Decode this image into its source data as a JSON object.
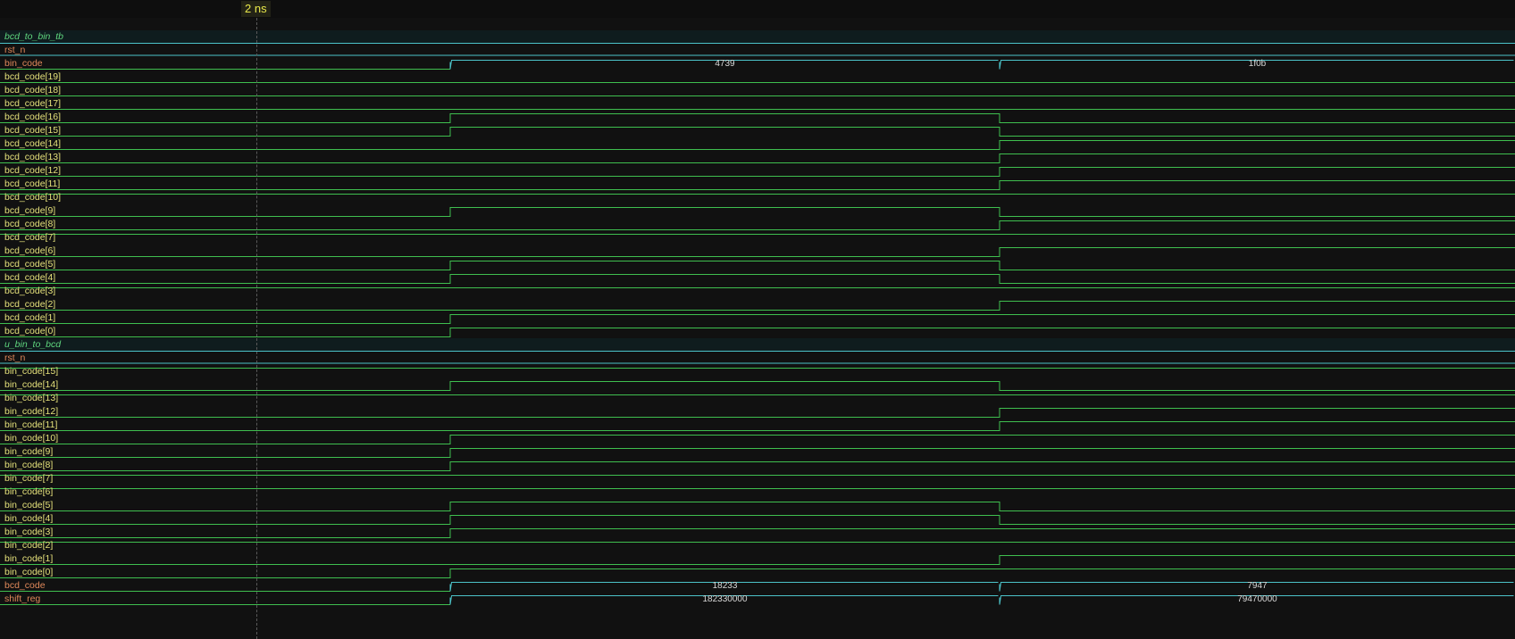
{
  "cursor": {
    "label": "2 ns"
  },
  "colors": {
    "background": "#111111",
    "group_label": "#5fd67e",
    "bit_label": "#e4e07a",
    "bus_label": "#e0885a",
    "wire": "#3fbf4f",
    "bus": "#4cc3c9",
    "cursor_bg": "#232316",
    "cursor_text": "#e8e84a"
  },
  "signals": [
    {
      "name": "bcd_to_bin_tb",
      "kind": "group"
    },
    {
      "name": "rst_n",
      "kind": "bus",
      "segments": [
        ""
      ]
    },
    {
      "name": "bin_code",
      "kind": "bus",
      "segments": [
        "",
        "4739",
        "1f0b"
      ]
    },
    {
      "name": "bcd_code[19]",
      "kind": "bit",
      "levels": [
        0,
        0,
        0
      ]
    },
    {
      "name": "bcd_code[18]",
      "kind": "bit",
      "levels": [
        0,
        0,
        0
      ]
    },
    {
      "name": "bcd_code[17]",
      "kind": "bit",
      "levels": [
        0,
        0,
        0
      ]
    },
    {
      "name": "bcd_code[16]",
      "kind": "bit",
      "levels": [
        0,
        1,
        0
      ]
    },
    {
      "name": "bcd_code[15]",
      "kind": "bit",
      "levels": [
        0,
        1,
        0
      ]
    },
    {
      "name": "bcd_code[14]",
      "kind": "bit",
      "levels": [
        0,
        0,
        1
      ]
    },
    {
      "name": "bcd_code[13]",
      "kind": "bit",
      "levels": [
        0,
        0,
        1
      ]
    },
    {
      "name": "bcd_code[12]",
      "kind": "bit",
      "levels": [
        0,
        0,
        1
      ]
    },
    {
      "name": "bcd_code[11]",
      "kind": "bit",
      "levels": [
        0,
        0,
        1
      ]
    },
    {
      "name": "bcd_code[10]",
      "kind": "bit",
      "levels": [
        1,
        1,
        1
      ]
    },
    {
      "name": "bcd_code[9]",
      "kind": "bit",
      "levels": [
        0,
        1,
        0
      ]
    },
    {
      "name": "bcd_code[8]",
      "kind": "bit",
      "levels": [
        0,
        0,
        1
      ]
    },
    {
      "name": "bcd_code[7]",
      "kind": "bit",
      "levels": [
        1,
        1,
        1
      ]
    },
    {
      "name": "bcd_code[6]",
      "kind": "bit",
      "levels": [
        0,
        0,
        1
      ]
    },
    {
      "name": "bcd_code[5]",
      "kind": "bit",
      "levels": [
        0,
        1,
        0
      ]
    },
    {
      "name": "bcd_code[4]",
      "kind": "bit",
      "levels": [
        0,
        1,
        0
      ]
    },
    {
      "name": "bcd_code[3]",
      "kind": "bit",
      "levels": [
        1,
        1,
        1
      ]
    },
    {
      "name": "bcd_code[2]",
      "kind": "bit",
      "levels": [
        0,
        0,
        1
      ]
    },
    {
      "name": "bcd_code[1]",
      "kind": "bit",
      "levels": [
        0,
        1,
        1
      ]
    },
    {
      "name": "bcd_code[0]",
      "kind": "bit",
      "levels": [
        0,
        1,
        1
      ]
    },
    {
      "name": "u_bin_to_bcd",
      "kind": "group"
    },
    {
      "name": "rst_n",
      "kind": "bus",
      "segments": [
        ""
      ]
    },
    {
      "name": "bin_code[15]",
      "kind": "bit",
      "levels": [
        1,
        1,
        1
      ]
    },
    {
      "name": "bin_code[14]",
      "kind": "bit",
      "levels": [
        0,
        1,
        0
      ]
    },
    {
      "name": "bin_code[13]",
      "kind": "bit",
      "levels": [
        1,
        1,
        1
      ]
    },
    {
      "name": "bin_code[12]",
      "kind": "bit",
      "levels": [
        0,
        0,
        1
      ]
    },
    {
      "name": "bin_code[11]",
      "kind": "bit",
      "levels": [
        0,
        0,
        1
      ]
    },
    {
      "name": "bin_code[10]",
      "kind": "bit",
      "levels": [
        0,
        1,
        1
      ]
    },
    {
      "name": "bin_code[9]",
      "kind": "bit",
      "levels": [
        0,
        1,
        1
      ]
    },
    {
      "name": "bin_code[8]",
      "kind": "bit",
      "levels": [
        0,
        1,
        1
      ]
    },
    {
      "name": "bin_code[7]",
      "kind": "bit",
      "levels": [
        1,
        1,
        1
      ]
    },
    {
      "name": "bin_code[6]",
      "kind": "bit",
      "levels": [
        1,
        1,
        1
      ]
    },
    {
      "name": "bin_code[5]",
      "kind": "bit",
      "levels": [
        0,
        1,
        0
      ]
    },
    {
      "name": "bin_code[4]",
      "kind": "bit",
      "levels": [
        0,
        1,
        0
      ]
    },
    {
      "name": "bin_code[3]",
      "kind": "bit",
      "levels": [
        0,
        1,
        1
      ]
    },
    {
      "name": "bin_code[2]",
      "kind": "bit",
      "levels": [
        1,
        1,
        1
      ]
    },
    {
      "name": "bin_code[1]",
      "kind": "bit",
      "levels": [
        0,
        0,
        1
      ]
    },
    {
      "name": "bin_code[0]",
      "kind": "bit",
      "levels": [
        0,
        1,
        1
      ]
    },
    {
      "name": "bcd_code",
      "kind": "bus",
      "segments": [
        "",
        "18233",
        "7947"
      ]
    },
    {
      "name": "shift_reg",
      "kind": "bus",
      "segments": [
        "",
        "182330000",
        "79470000"
      ]
    }
  ]
}
